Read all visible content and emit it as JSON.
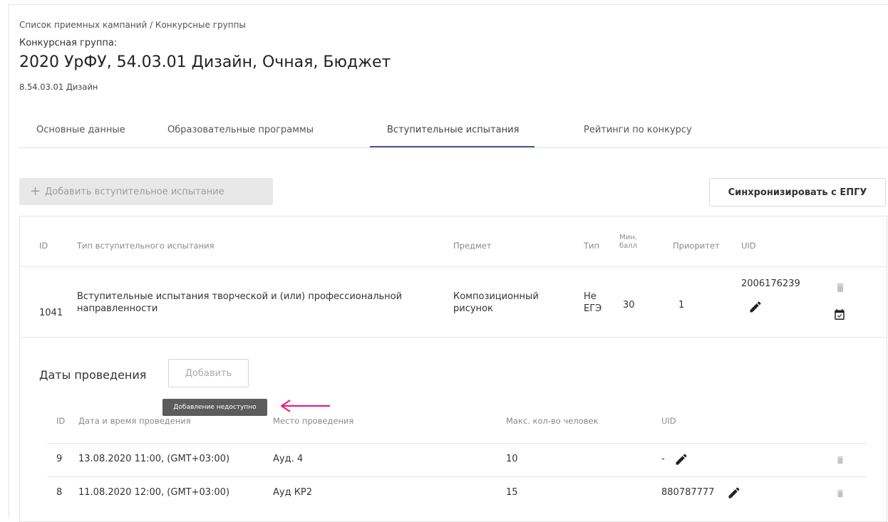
{
  "breadcrumb": "Список приемных кампаний / Конкурсные группы",
  "group": {
    "label": "Конкурсная группа:",
    "title": "2020 УрФУ, 54.03.01 Дизайн, Очная, Бюджет",
    "code": "8.54.03.01 Дизайн"
  },
  "tabs": [
    {
      "label": "Основные данные",
      "active": false
    },
    {
      "label": "Образовательные программы",
      "active": false
    },
    {
      "label": "Вступительные испытания",
      "active": true
    },
    {
      "label": "Рейтинги по конкурсу",
      "active": false
    }
  ],
  "toolbar": {
    "add_exam_plus": "+",
    "add_exam_label": "Добавить вступительное испытание",
    "sync_label": "Синхронизировать с ЕПГУ"
  },
  "exam_table": {
    "headers": {
      "id": "ID",
      "type": "Тип вступительного испытания",
      "subject": "Предмет",
      "kind": "Тип",
      "min_score_line1": "Мин.",
      "min_score_line2": "балл",
      "priority": "Приоритет",
      "uid": "UID"
    },
    "rows": [
      {
        "id": "1041",
        "type_line1": "Вступительные испытания творческой и (или) профессиональной",
        "type_line2": "направленности",
        "subject_line1": "Композиционный",
        "subject_line2": "рисунок",
        "kind_line1": "Не",
        "kind_line2": "ЕГЭ",
        "min_score": "30",
        "priority": "1",
        "uid": "2006176239"
      }
    ]
  },
  "dates": {
    "label": "Даты проведения",
    "add_label": "Добавить",
    "tooltip": "Добавление недоступно",
    "headers": {
      "id": "ID",
      "datetime": "Дата и время проведения",
      "place": "Место проведения",
      "max_people": "Макс. кол-во человек",
      "uid": "UID"
    },
    "rows": [
      {
        "id": "9",
        "datetime": "13.08.2020 11:00, (GMT+03:00)",
        "place": "Ауд. 4",
        "max_people": "10",
        "uid": "-"
      },
      {
        "id": "8",
        "datetime": "11.08.2020 12:00, (GMT+03:00)",
        "place": "Ауд КР2",
        "max_people": "15",
        "uid": "880787777"
      }
    ]
  },
  "colors": {
    "tab_active_underline": "#4a5a8a",
    "annotation_arrow": "#e8207a",
    "icon": "#222222",
    "icon_muted": "#c4c4c4"
  }
}
